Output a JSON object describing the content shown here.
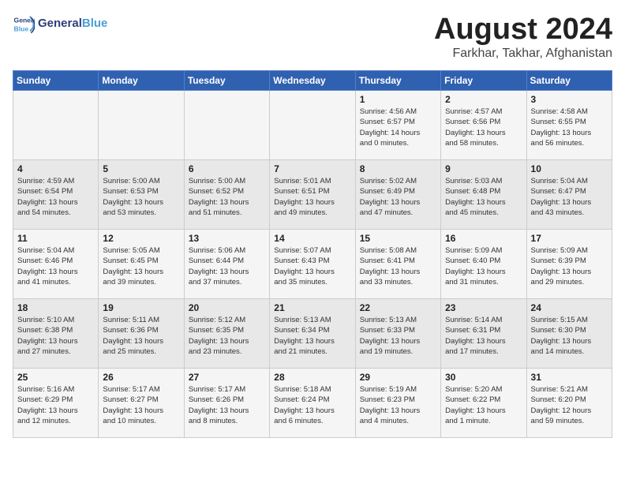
{
  "header": {
    "logo_text_general": "General",
    "logo_text_blue": "Blue",
    "month_year": "August 2024",
    "location": "Farkhar, Takhar, Afghanistan"
  },
  "days_of_week": [
    "Sunday",
    "Monday",
    "Tuesday",
    "Wednesday",
    "Thursday",
    "Friday",
    "Saturday"
  ],
  "weeks": [
    [
      {
        "day": "",
        "detail": ""
      },
      {
        "day": "",
        "detail": ""
      },
      {
        "day": "",
        "detail": ""
      },
      {
        "day": "",
        "detail": ""
      },
      {
        "day": "1",
        "detail": "Sunrise: 4:56 AM\nSunset: 6:57 PM\nDaylight: 14 hours\nand 0 minutes."
      },
      {
        "day": "2",
        "detail": "Sunrise: 4:57 AM\nSunset: 6:56 PM\nDaylight: 13 hours\nand 58 minutes."
      },
      {
        "day": "3",
        "detail": "Sunrise: 4:58 AM\nSunset: 6:55 PM\nDaylight: 13 hours\nand 56 minutes."
      }
    ],
    [
      {
        "day": "4",
        "detail": "Sunrise: 4:59 AM\nSunset: 6:54 PM\nDaylight: 13 hours\nand 54 minutes."
      },
      {
        "day": "5",
        "detail": "Sunrise: 5:00 AM\nSunset: 6:53 PM\nDaylight: 13 hours\nand 53 minutes."
      },
      {
        "day": "6",
        "detail": "Sunrise: 5:00 AM\nSunset: 6:52 PM\nDaylight: 13 hours\nand 51 minutes."
      },
      {
        "day": "7",
        "detail": "Sunrise: 5:01 AM\nSunset: 6:51 PM\nDaylight: 13 hours\nand 49 minutes."
      },
      {
        "day": "8",
        "detail": "Sunrise: 5:02 AM\nSunset: 6:49 PM\nDaylight: 13 hours\nand 47 minutes."
      },
      {
        "day": "9",
        "detail": "Sunrise: 5:03 AM\nSunset: 6:48 PM\nDaylight: 13 hours\nand 45 minutes."
      },
      {
        "day": "10",
        "detail": "Sunrise: 5:04 AM\nSunset: 6:47 PM\nDaylight: 13 hours\nand 43 minutes."
      }
    ],
    [
      {
        "day": "11",
        "detail": "Sunrise: 5:04 AM\nSunset: 6:46 PM\nDaylight: 13 hours\nand 41 minutes."
      },
      {
        "day": "12",
        "detail": "Sunrise: 5:05 AM\nSunset: 6:45 PM\nDaylight: 13 hours\nand 39 minutes."
      },
      {
        "day": "13",
        "detail": "Sunrise: 5:06 AM\nSunset: 6:44 PM\nDaylight: 13 hours\nand 37 minutes."
      },
      {
        "day": "14",
        "detail": "Sunrise: 5:07 AM\nSunset: 6:43 PM\nDaylight: 13 hours\nand 35 minutes."
      },
      {
        "day": "15",
        "detail": "Sunrise: 5:08 AM\nSunset: 6:41 PM\nDaylight: 13 hours\nand 33 minutes."
      },
      {
        "day": "16",
        "detail": "Sunrise: 5:09 AM\nSunset: 6:40 PM\nDaylight: 13 hours\nand 31 minutes."
      },
      {
        "day": "17",
        "detail": "Sunrise: 5:09 AM\nSunset: 6:39 PM\nDaylight: 13 hours\nand 29 minutes."
      }
    ],
    [
      {
        "day": "18",
        "detail": "Sunrise: 5:10 AM\nSunset: 6:38 PM\nDaylight: 13 hours\nand 27 minutes."
      },
      {
        "day": "19",
        "detail": "Sunrise: 5:11 AM\nSunset: 6:36 PM\nDaylight: 13 hours\nand 25 minutes."
      },
      {
        "day": "20",
        "detail": "Sunrise: 5:12 AM\nSunset: 6:35 PM\nDaylight: 13 hours\nand 23 minutes."
      },
      {
        "day": "21",
        "detail": "Sunrise: 5:13 AM\nSunset: 6:34 PM\nDaylight: 13 hours\nand 21 minutes."
      },
      {
        "day": "22",
        "detail": "Sunrise: 5:13 AM\nSunset: 6:33 PM\nDaylight: 13 hours\nand 19 minutes."
      },
      {
        "day": "23",
        "detail": "Sunrise: 5:14 AM\nSunset: 6:31 PM\nDaylight: 13 hours\nand 17 minutes."
      },
      {
        "day": "24",
        "detail": "Sunrise: 5:15 AM\nSunset: 6:30 PM\nDaylight: 13 hours\nand 14 minutes."
      }
    ],
    [
      {
        "day": "25",
        "detail": "Sunrise: 5:16 AM\nSunset: 6:29 PM\nDaylight: 13 hours\nand 12 minutes."
      },
      {
        "day": "26",
        "detail": "Sunrise: 5:17 AM\nSunset: 6:27 PM\nDaylight: 13 hours\nand 10 minutes."
      },
      {
        "day": "27",
        "detail": "Sunrise: 5:17 AM\nSunset: 6:26 PM\nDaylight: 13 hours\nand 8 minutes."
      },
      {
        "day": "28",
        "detail": "Sunrise: 5:18 AM\nSunset: 6:24 PM\nDaylight: 13 hours\nand 6 minutes."
      },
      {
        "day": "29",
        "detail": "Sunrise: 5:19 AM\nSunset: 6:23 PM\nDaylight: 13 hours\nand 4 minutes."
      },
      {
        "day": "30",
        "detail": "Sunrise: 5:20 AM\nSunset: 6:22 PM\nDaylight: 13 hours\nand 1 minute."
      },
      {
        "day": "31",
        "detail": "Sunrise: 5:21 AM\nSunset: 6:20 PM\nDaylight: 12 hours\nand 59 minutes."
      }
    ]
  ]
}
